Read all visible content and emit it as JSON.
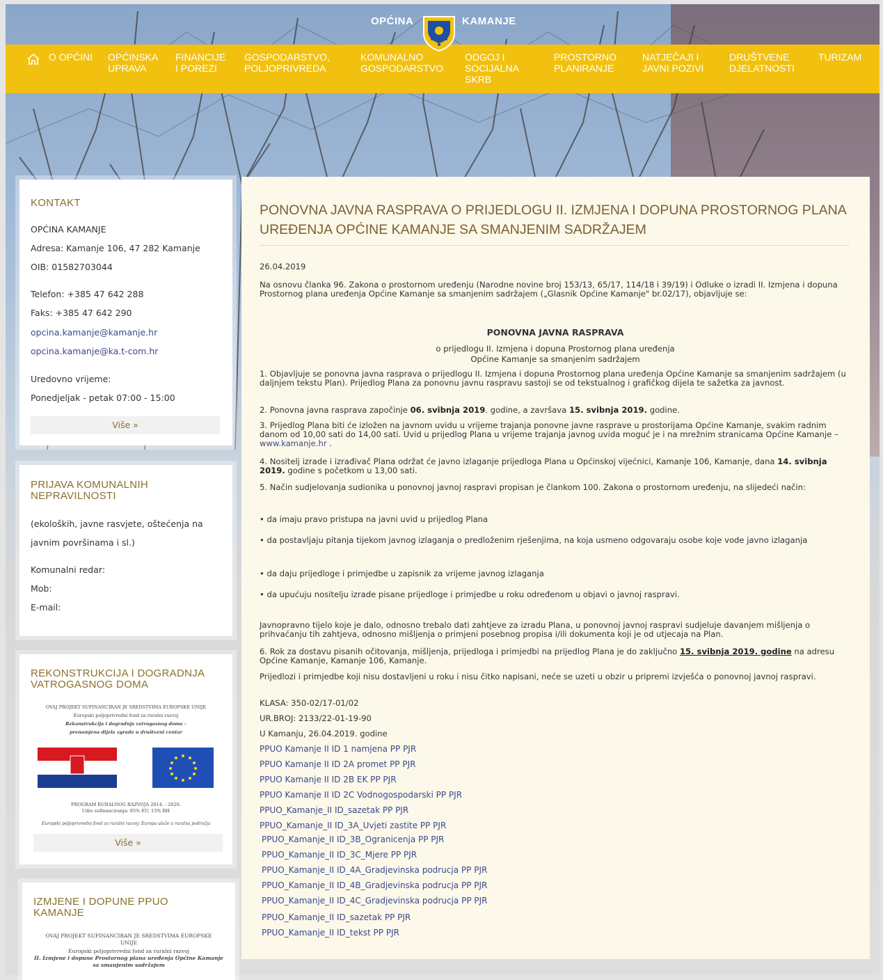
{
  "header": {
    "brand_left": "OPĆINA",
    "brand_right": "KAMANJE",
    "nav": [
      "O OPĆINI",
      "OPĆINSKA\nUPRAVA",
      "FINANCIJE\nI POREZI",
      "GOSPODARSTVO,\nPOLJOPRIVREDA",
      "KOMUNALNO\nGOSPODARSTVO",
      "ODGOJ I\nSOCIJALNA\nSKRB",
      "PROSTORNO\nPLANIRANJE",
      "NATJEČAJI I\nJAVNI POZIVI",
      "DRUŠTVENE\nDJELATNOSTI",
      "TURIZAM"
    ]
  },
  "kontakt": {
    "title": "KONTAKT",
    "org": "OPĆINA KAMANJE",
    "address": "Adresa: Kamanje 106, 47 282 Kamanje",
    "oib": "OIB: 01582703044",
    "phone": "Telefon: +385 47 642 288",
    "fax": "Faks: +385 47 642 290",
    "email1": "opcina.kamanje@kamanje.hr",
    "email2": "opcina.kamanje@ka.t-com.hr",
    "hours_label": "Uredovno vrijeme:",
    "hours": "Ponedjeljak - petak 07:00 - 15:00",
    "more": "Više »"
  },
  "prijava": {
    "title": "PRIJAVA KOMUNALNIH NEPRAVILNOSTI",
    "desc1": "(ekoloških, javne rasvjete, oštećenja na",
    "desc2": "javnim površinama i sl.)",
    "redar": "Komunalni redar:",
    "mob": "Mob:",
    "email": "E-mail:"
  },
  "rekonstrukcija": {
    "title": "REKONSTRUKCIJA I DOGRADNJA VATROGASNOG DOMA",
    "line1": "OVAJ PROJEKT SUFINANCIRAN JE SREDSTVIMA EUROPSKE UNIJE",
    "line2": "Europski poljoprivredni fond za ruralni razvoj",
    "line3": "Rekonstrukcija i dogradnja vatrogasnog doma –",
    "line4": "prenamjena dijela zgrade u društveni centar",
    "line5": "PROGRAM RURALNOG RAZVOJA 2014. - 2020.",
    "line6": "Udio sufinanciranja: 85% EU, 15% RH",
    "line7": "Europski poljoprivredni fond za ruralni razvoj: Europa ulaže u ruralna područja",
    "more": "Više »"
  },
  "izmjene": {
    "title": "IZMJENE I DOPUNE PPUO KAMANJE",
    "line1": "OVAJ PROJEKT SUFINANCIRAN JE SREDSTVIMA EUROPSKE",
    "line1b": "UNIJE",
    "line2": "Europski poljoprivredni fond za ruralni razvoj",
    "line3": "II. Izmjene i dopune Prostornog plana uređenja Općine Kamanje",
    "line4": "sa smanjenim sadržajem"
  },
  "article": {
    "title": "PONOVNA JAVNA RASPRAVA O PRIJEDLOGU II. IZMJENA I DOPUNA PROSTORNOG PLANA UREĐENJA OPĆINE KAMANJE SA SMANJENIM SADRŽAJEM",
    "date": "26.04.2019",
    "intro": "Na osnovu članka 96. Zakona o prostornom uređenju (Narodne novine broj 153/13, 65/17, 114/18 i 39/19) i Odluke o izradi II. Izmjena i dopuna Prostornog plana uređenja Općine Kamanje sa smanjenim sadržajem („Glasnik Općine Kamanje\" br.02/17), objavljuje se:",
    "heading": "PONOVNA JAVNA RASPRAVA",
    "sub1": "o prijedlogu II. Izmjena i dopuna Prostornog plana uređenja",
    "sub2": "Općine Kamanje sa smanjenim sadržajem",
    "p1": "1. Objavljuje se ponovna javna rasprava o prijedlogu II. Izmjena i dopuna Prostornog plana uređenja Općine Kamanje sa smanjenim sadržajem (u daljnjem tekstu Plan). Prijedlog Plana za ponovnu javnu raspravu sastoji se od tekstualnog i grafičkog dijela te sažetka za javnost.",
    "p2a": "2. Ponovna javna rasprava započinje ",
    "p2b": "06. svibnja 2019",
    "p2c": ". godine, a završava ",
    "p2d": "15. svibnja 2019.",
    "p2e": " godine.",
    "p3": "3. Prijedlog Plana biti će izložen na javnom uvidu u vrijeme trajanja ponovne javne rasprave u prostorijama Općine Kamanje, svakim radnim danom od 10,00 sati do 14,00 sati. Uvid u prijedlog Plana u vrijeme trajanja javnog uvida moguć je i na mrežnim stranicama Općine Kamanje – ",
    "p3link": "www.kamanje.hr",
    "p3end": " .",
    "p4a": "4. Nositelj izrade i izrađivač Plana održat će javno izlaganje prijedloga Plana u Općinskoj vijećnici, Kamanje 106, Kamanje, dana ",
    "p4b": "14. svibnja 2019.",
    "p4c": " godine s početkom u 13,00 sati.",
    "p5": "5. Način sudjelovanja sudionika u ponovnoj javnoj raspravi propisan je člankom 100. Zakona o prostornom uređenju, na slijedeći način:",
    "b1": "• da imaju pravo pristupa na javni uvid u prijedlog Plana",
    "b2": "• da postavljaju pitanja tijekom javnog izlaganja o predloženim rješenjima, na koja usmeno odgovaraju osobe koje vode javno izlaganja",
    "b3": "• da daju prijedloge i primjedbe u zapisnik za vrijeme javnog izlaganja",
    "b4": "• da upućuju nositelju izrade pisane prijedloge i primjedbe u roku određenom u objavi o javnoj raspravi.",
    "p6": "Javnopravno tijelo koje je dalo, odnosno trebalo dati zahtjeve za izradu Plana, u ponovnoj javnoj raspravi sudjeluje davanjem mišljenja o prihvaćanju tih zahtjeva, odnosno mišljenja o primjeni posebnog propisa i/ili dokumenta koji je od utjecaja na Plan.",
    "p7a": "6. Rok za dostavu pisanih očitovanja, mišljenja, prijedloga i primjedbi na prijedlog Plana je do zaključno ",
    "p7b": "15. svibnja 2019. godine",
    "p7c": " na adresu Općine Kamanje, Kamanje 106, Kamanje.",
    "p8": "Prijedlozi i primjedbe koji nisu dostavljeni u roku i nisu čitko napisani, neće se uzeti u obzir u pripremi izvješća o ponovnoj javnoj raspravi.",
    "klasa": "KLASA: 350-02/17-01/02",
    "urbroj": "UR.BROJ: 2133/22-01-19-90",
    "place": "U Kamanju, 26.04.2019. godine",
    "links": [
      "PPUO Kamanje II ID 1 namjena PP PJR",
      "PPUO Kamanje II ID 2A promet PP PJR",
      "PPUO Kamanje II ID 2B EK PP PJR",
      "PPUO Kamanje II ID 2C Vodnogospodarski PP PJR",
      "PPUO_Kamanje_II ID_sazetak PP PJR",
      "PPUO_Kamanje_II ID_3A_Uvjeti zastite PP PJR",
      "PPUO_Kamanje_II ID_3B_Ogranicenja PP PJR",
      "PPUO_Kamanje_II ID_3C_Mjere PP PJR",
      "PPUO_Kamanje_II ID_4A_Gradjevinska podrucja PP PJR",
      "PPUO_Kamanje_II ID_4B_Gradjevinska podrucja PP PJR",
      "PPUO_Kamanje_II ID_4C_Gradjevinska podrucja PP PJR",
      "PPUO_Kamanje_II ID_sazetak PP PJR",
      "PPUO_Kamanje_II ID_tekst PP PJR"
    ]
  }
}
